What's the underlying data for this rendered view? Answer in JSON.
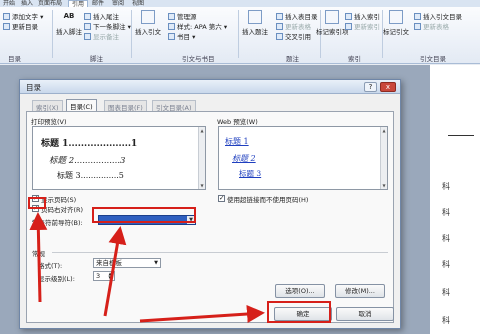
{
  "ribbon": {
    "tabs": [
      "开始",
      "插入",
      "页面布局",
      "引用",
      "邮件",
      "审阅",
      "视图"
    ],
    "toc_group": {
      "add_text": "添加文字",
      "update_toc": "更新目录",
      "name": "目录"
    },
    "footnote_group": {
      "insert_footnote_big": "插入脚注",
      "insert_endnote": "插入尾注",
      "next_footnote": "下一条脚注",
      "show_notes": "显示备注",
      "name": "脚注"
    },
    "citation_group": {
      "insert_citation": "插入引文",
      "manage_sources": "管理源",
      "style_label": "样式:",
      "style_value": "APA 第六",
      "bibliography": "书目",
      "name": "引文与书目"
    },
    "caption_group": {
      "insert_caption": "插入题注",
      "insert_table_of_figures": "插入表目录",
      "update_table": "更新表格",
      "cross_reference": "交叉引用",
      "name": "题注"
    },
    "index_group": {
      "mark_entry": "标记索引项",
      "insert_index": "插入索引",
      "update_index": "更新索引",
      "name": "索引"
    },
    "toa_group": {
      "mark_citation": "标记引文",
      "insert_toa": "插入引文目录",
      "update_table": "更新表格",
      "name": "引文目录"
    },
    "ab_label": "AB"
  },
  "dialog": {
    "title": "目录",
    "help_glyph": "?",
    "close_glyph": "x",
    "tabs": [
      "索引(X)",
      "目录(C)",
      "图表目录(F)",
      "引文目录(A)"
    ],
    "print_preview": {
      "label": "打印预览(V)",
      "lines": [
        {
          "text": "标题 1....................1"
        },
        {
          "text": "标题 2.................3"
        },
        {
          "text": "标题 3...............5"
        }
      ]
    },
    "web_preview": {
      "label": "Web 预览(W)",
      "lines": [
        "标题 1",
        "标题 2",
        "标题 3"
      ]
    },
    "show_page_numbers": {
      "label": "显示页码(S)",
      "checked": true
    },
    "right_align": {
      "label": "页码右对齐(R)",
      "checked": true
    },
    "tab_leader": {
      "label": "制表符前导符(B):",
      "value": "......."
    },
    "use_hyperlinks": {
      "label": "使用超链接而不使用页码(H)",
      "checked": true
    },
    "general_label": "常规",
    "formats": {
      "label": "格式(T):",
      "value": "来自模板"
    },
    "show_levels": {
      "label": "显示级别(L):",
      "value": "3"
    },
    "options_button": "选项(O)...",
    "modify_button": "修改(M)...",
    "ok_button": "确定",
    "cancel_button": "取消"
  },
  "document": {
    "lines": [
      "科",
      "科",
      "科",
      "科",
      "科",
      "科"
    ]
  },
  "colors": {
    "annotation_red": "#d6201a",
    "accent_blue": "#1f3fbf"
  }
}
